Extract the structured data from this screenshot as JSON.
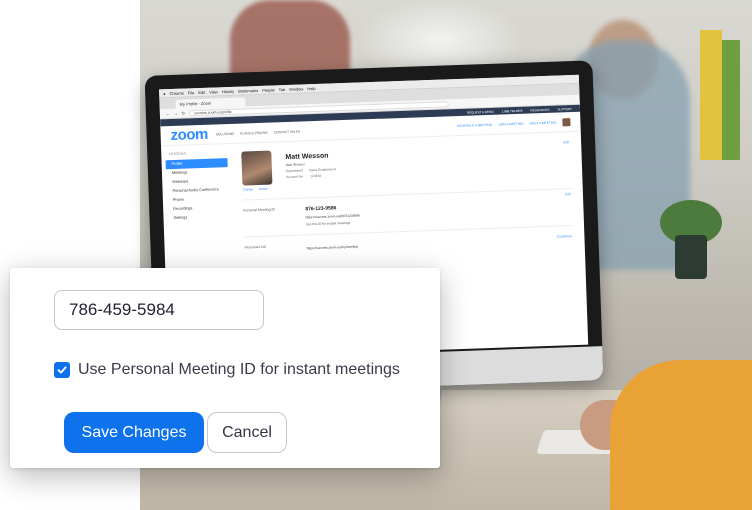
{
  "browser": {
    "menu": [
      "Chrome",
      "File",
      "Edit",
      "View",
      "History",
      "Bookmarks",
      "People",
      "Tab",
      "Window",
      "Help"
    ],
    "tab_title": "My Profile - Zoom",
    "url": "success.zoom.us/profile"
  },
  "zoom_site": {
    "logo": "zoom",
    "top_links": [
      "REQUEST A DEMO",
      "1.888.799.9666",
      "RESOURCES",
      "SUPPORT"
    ],
    "nav": [
      "SOLUTIONS",
      "PLANS & PRICING",
      "CONTACT SALES"
    ],
    "nav_right": [
      "SCHEDULE A MEETING",
      "JOIN A MEETING",
      "HOST A MEETING"
    ],
    "sidebar_heading": "PERSONAL",
    "sidebar_items": [
      "Profile",
      "Meetings",
      "Webinars",
      "Personal Audio Conference",
      "Phone",
      "Recordings",
      "Settings"
    ],
    "profile": {
      "name": "Matt Wesson",
      "subname": "Matt Wesson",
      "department_label": "Department",
      "department_value": "Sales Enablement",
      "account_label": "Account No.",
      "account_value": "123456",
      "avatar_links": [
        "Change",
        "Delete"
      ],
      "edit": "Edit"
    },
    "pmi": {
      "label": "Personal Meeting ID",
      "number": "876-123-9586",
      "link": "https://success.zoom.us/j/8761239586",
      "check": "Use this ID for instant meetings",
      "edit": "Edit"
    },
    "personal_link": {
      "label": "Personal Link",
      "link": "https://success.zoom.us/my/meeting",
      "action": "Customize"
    }
  },
  "dialog": {
    "pmi_value": "786-459-5984",
    "checkbox_label": "Use Personal Meeting ID for instant meetings",
    "checkbox_checked": true,
    "save_label": "Save Changes",
    "cancel_label": "Cancel"
  },
  "colors": {
    "accent": "#0e72ed",
    "zoom_blue": "#2d8cff"
  }
}
